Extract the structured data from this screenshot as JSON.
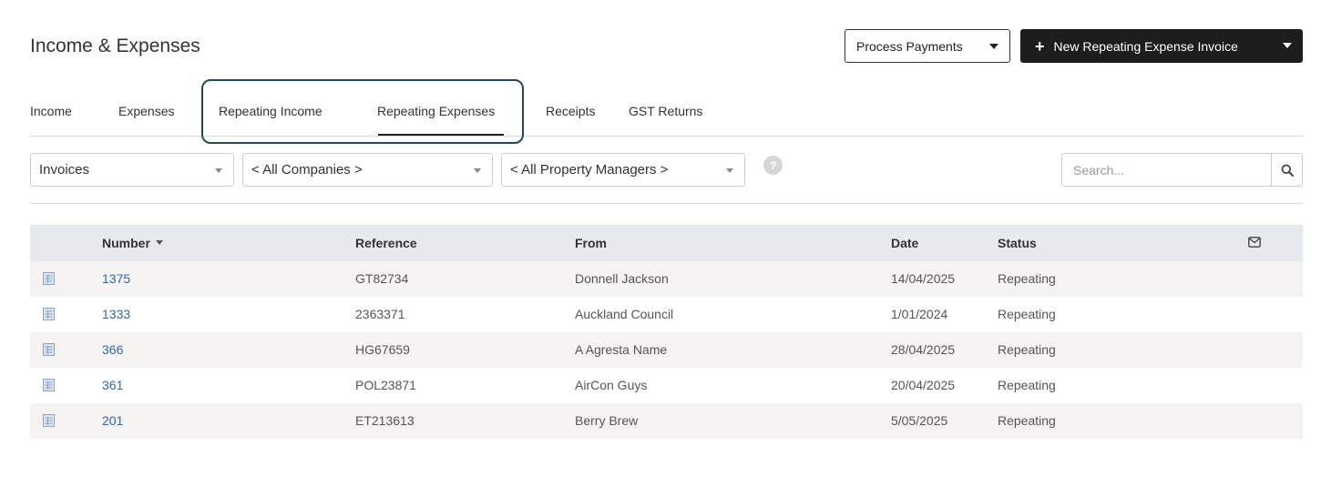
{
  "header": {
    "title": "Income & Expenses",
    "process_payments_label": "Process Payments",
    "new_invoice_label": "New Repeating Expense Invoice"
  },
  "tabs": [
    {
      "label": "Income"
    },
    {
      "label": "Expenses"
    },
    {
      "label": "Repeating Income"
    },
    {
      "label": "Repeating Expenses",
      "active": true
    },
    {
      "label": "Receipts"
    },
    {
      "label": "GST Returns"
    }
  ],
  "filters": {
    "type": "Invoices",
    "company": "< All Companies >",
    "property_manager": "< All Property Managers >",
    "help": "?",
    "search_placeholder": "Search..."
  },
  "table": {
    "columns": {
      "number": "Number",
      "reference": "Reference",
      "from": "From",
      "date": "Date",
      "status": "Status"
    },
    "rows": [
      {
        "number": "1375",
        "reference": "GT82734",
        "from": "Donnell Jackson",
        "date": "14/04/2025",
        "status": "Repeating"
      },
      {
        "number": "1333",
        "reference": "2363371",
        "from": "Auckland Council",
        "date": "1/01/2024",
        "status": "Repeating"
      },
      {
        "number": "366",
        "reference": "HG67659",
        "from": "A Agresta Name",
        "date": "28/04/2025",
        "status": "Repeating"
      },
      {
        "number": "361",
        "reference": "POL23871",
        "from": "AirCon Guys",
        "date": "20/04/2025",
        "status": "Repeating"
      },
      {
        "number": "201",
        "reference": "ET213613",
        "from": "Berry Brew",
        "date": "5/05/2025",
        "status": "Repeating"
      }
    ]
  },
  "colors": {
    "accent_dark": "#1d1d1d",
    "link": "#2f69b3",
    "highlight_border": "#1f4a5e",
    "header_bg": "#e6eaef"
  }
}
